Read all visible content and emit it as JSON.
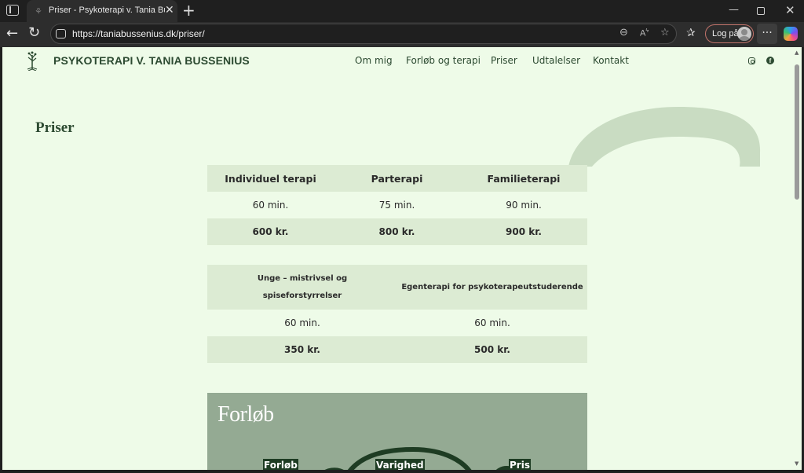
{
  "browser": {
    "tab_title": "Priser - Psykoterapi v. Tania Bussenius",
    "url": "https://taniabussenius.dk/priser/",
    "login_label": "Log på"
  },
  "site": {
    "title": "PSYKOTERAPI V. TANIA BUSSENIUS",
    "nav": [
      "Om mig",
      "Forløb og terapi",
      "Priser",
      "Udtalelser",
      "Kontakt"
    ]
  },
  "page": {
    "title": "Priser",
    "table1": {
      "headers": [
        "Individuel terapi",
        "Parterapi",
        "Familieterapi"
      ],
      "durations": [
        "60 min.",
        "75 min.",
        "90 min."
      ],
      "prices": [
        "600 kr.",
        "800 kr.",
        "900 kr."
      ]
    },
    "table2": {
      "headers": [
        "Unge – mistrivsel og spiseforstyrrelser",
        "Egenterapi for psykoterapeutstuderende"
      ],
      "durations": [
        "60 min.",
        "60 min."
      ],
      "prices": [
        "350 kr.",
        "500 kr."
      ]
    },
    "forloeb": {
      "title": "Forløb",
      "labels": [
        "Forløb",
        "Varighed",
        "Pris"
      ]
    }
  },
  "colors": {
    "page_bg": "#eefbe8",
    "table_band": "#dcebd3",
    "brand_green": "#2c4a31",
    "forloeb_bg": "#94aa93",
    "label_bg": "#1e3c23"
  }
}
